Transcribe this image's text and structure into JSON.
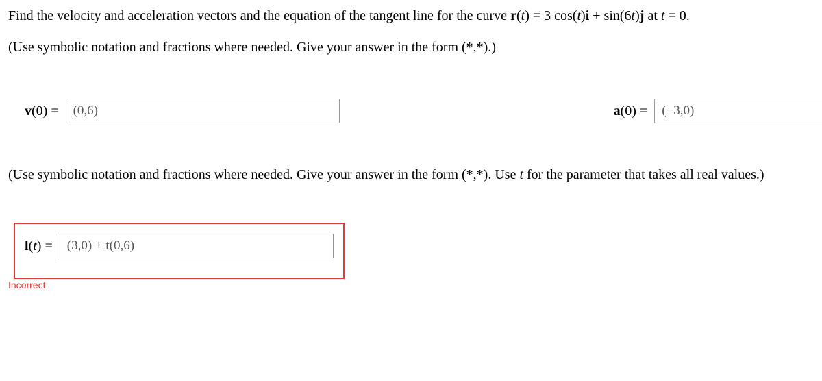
{
  "question": {
    "line1_prefix": "Find the velocity and acceleration vectors and the equation of the tangent line for the curve ",
    "r_label": "r",
    "r_of_t": "(",
    "t_var": "t",
    "close_paren": ") = 3 cos(",
    "after_cos": ")",
    "i_label": "i",
    "plus_sin": " + sin(6",
    "after_sin": ")",
    "j_label": "j",
    "at_text": " at ",
    "t_eq": " = 0."
  },
  "instruction1": "(Use symbolic notation and fractions where needed. Give your answer in the form (*,*).)",
  "instruction2_prefix": "(Use symbolic notation and fractions where needed. Give your answer in the form (*,*). Use ",
  "instruction2_t": "t",
  "instruction2_suffix": " for the parameter that takes all real values.)",
  "answers": {
    "v": {
      "label_bold": "v",
      "label_rest": "(0) =",
      "value": "(0,6)"
    },
    "a": {
      "label_bold": "a",
      "label_rest": "(0) =",
      "value": "(−3,0)"
    },
    "l": {
      "label_bold": "l",
      "label_paren_open": "(",
      "label_t": "t",
      "label_rest": ") =",
      "value": "(3,0) + t(0,6)"
    }
  },
  "incorrect_label": "Incorrect"
}
